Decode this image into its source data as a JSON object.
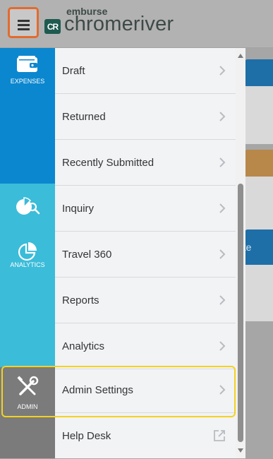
{
  "header": {
    "brand_small": "emburse",
    "brand_name": "chromeriver",
    "logo_mark": "CR",
    "menu_icon": "hamburger-menu-icon"
  },
  "background": {
    "card_text": "ate"
  },
  "sidebar": {
    "sections": [
      {
        "label": "EXPENSES",
        "icon": "wallet-icon",
        "color": "#0b87cf"
      },
      {
        "label": "ANALYTICS",
        "icon": "pie-chart-icon",
        "color": "#3bbcd9"
      },
      {
        "label": "ADMIN",
        "icon": "tools-icon",
        "color": "#7b7b7b"
      }
    ],
    "extra_icons": [
      "inquiry-magnifier-icon"
    ]
  },
  "menu": {
    "items": [
      {
        "label": "Draft"
      },
      {
        "label": "Returned"
      },
      {
        "label": "Recently Submitted"
      },
      {
        "label": "Inquiry"
      },
      {
        "label": "Travel 360"
      },
      {
        "label": "Reports"
      },
      {
        "label": "Analytics"
      },
      {
        "label": "Admin Settings",
        "highlighted": true
      },
      {
        "label": "Help Desk",
        "external": true
      }
    ]
  },
  "colors": {
    "highlight": "#f4d21f",
    "hamburger_border": "#e26b2f"
  }
}
